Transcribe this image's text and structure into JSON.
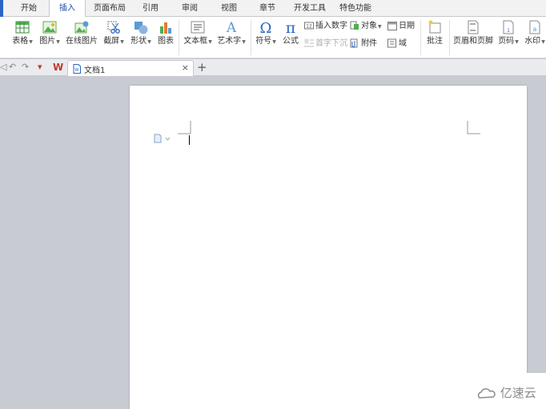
{
  "colors": {
    "accent": "#2b65c4",
    "ribbon_bg": "#ffffff",
    "canvas_bg": "#c9cbd2"
  },
  "menu_tabs": [
    "开始",
    "插入",
    "页面布局",
    "引用",
    "审阅",
    "视图",
    "章节",
    "开发工具",
    "特色功能"
  ],
  "active_tab": "插入",
  "ribbon": {
    "table": "表格",
    "picture": "图片",
    "online_picture": "在线图片",
    "screenshot": "截屏",
    "shapes": "形状",
    "chart": "图表",
    "textbox": "文本框",
    "wordart": "艺术字",
    "symbol": "符号",
    "formula": "公式",
    "insert_number": "插入数字",
    "drop_cap": "首字下沉",
    "object": "对象",
    "attachment": "附件",
    "date": "日期",
    "field": "域",
    "comment": "批注",
    "header_footer": "页眉和页脚",
    "page_number": "页码",
    "watermark": "水印"
  },
  "document_tab": {
    "name": "文档1",
    "close": "×",
    "new_tab": "+"
  },
  "quick_access_icons": [
    "undo-icon",
    "redo-icon",
    "wps-logo-icon"
  ],
  "watermark_text": "亿速云"
}
